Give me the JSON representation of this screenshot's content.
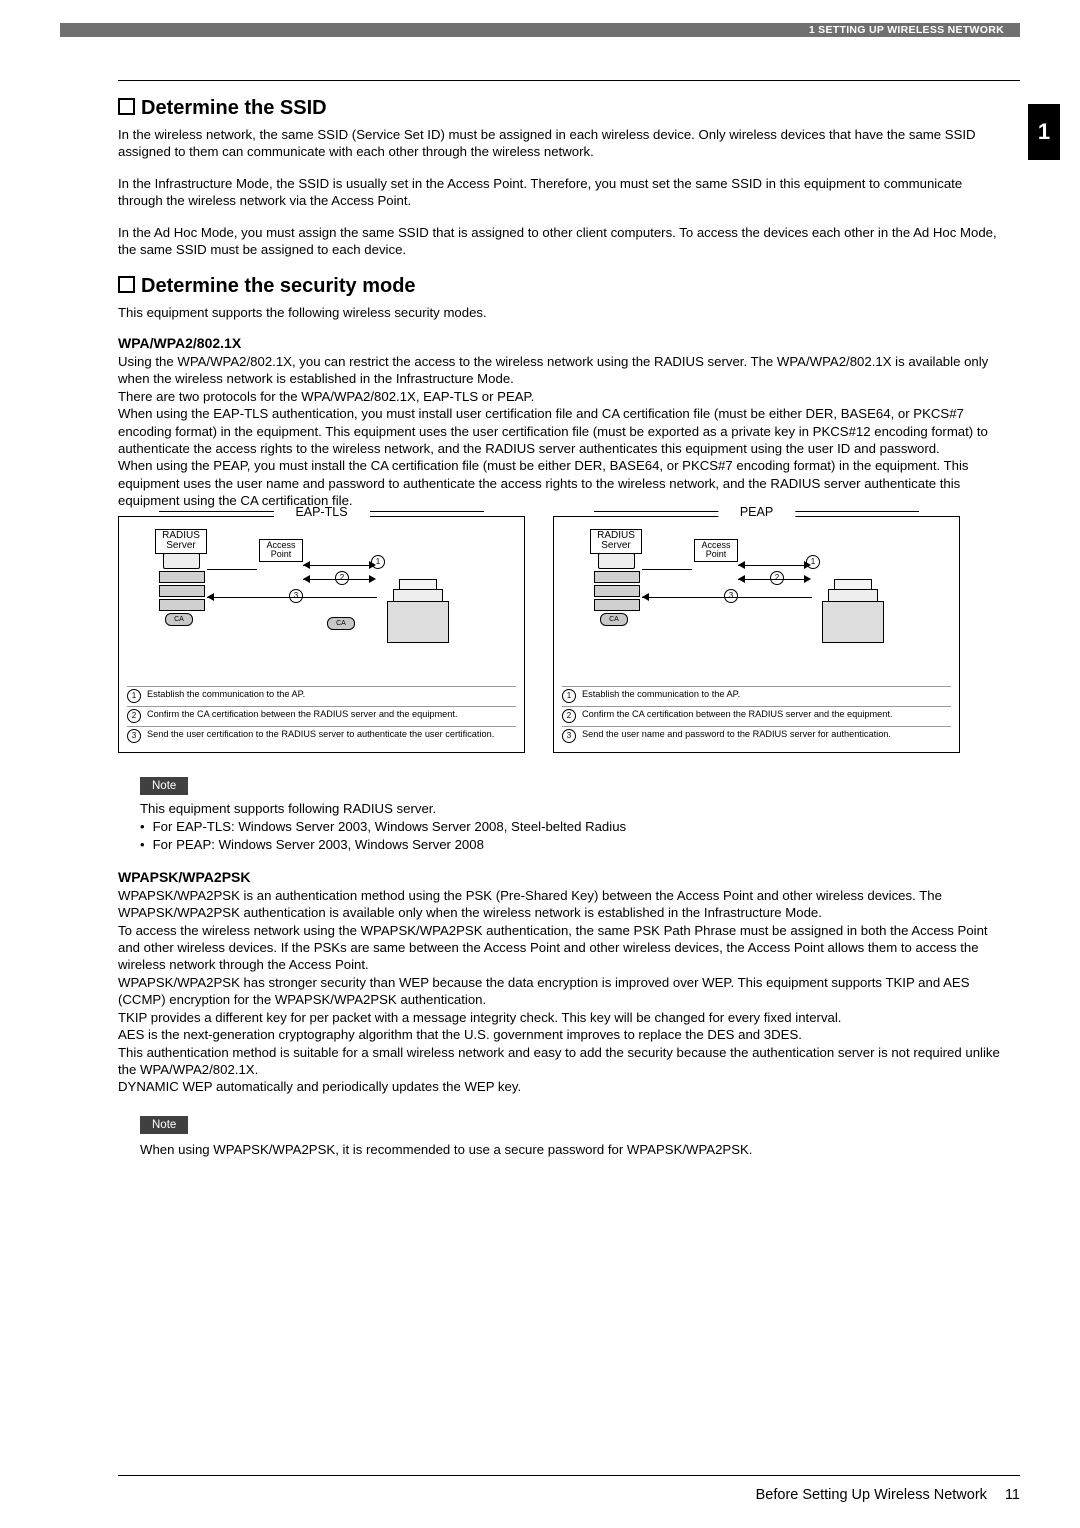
{
  "header": {
    "breadcrumb": "1 SETTING UP WIRELESS NETWORK",
    "chapter_tab": "1"
  },
  "sections": {
    "ssid": {
      "title": "Determine the SSID",
      "p1": "In the wireless network, the same SSID (Service Set ID) must be assigned in each wireless device.  Only wireless devices that have the same SSID assigned to them can communicate with each other through the wireless network.",
      "p2": "In the Infrastructure Mode, the SSID is usually set in the Access Point. Therefore, you must set the same SSID in this equipment to communicate through the wireless network via the Access Point.",
      "p3": "In the Ad Hoc Mode, you must assign the same SSID that is assigned to other client computers.  To access the devices each other in the Ad Hoc Mode, the same SSID must be assigned to each device."
    },
    "security": {
      "title": "Determine the security mode",
      "intro": "This equipment supports the following wireless security modes.",
      "wpa8021x": {
        "heading": "WPA/WPA2/802.1X",
        "body": "Using the WPA/WPA2/802.1X, you can restrict the access to the wireless network using the RADIUS server. The WPA/WPA2/802.1X is available only when the wireless network is established in the Infrastructure Mode.\nThere are two protocols for the WPA/WPA2/802.1X, EAP-TLS or PEAP.\nWhen using the EAP-TLS authentication, you must install user certification file and CA certification file (must be either DER, BASE64, or PKCS#7 encoding format) in the equipment. This equipment uses the user certification file (must be exported as a private key in PKCS#12 encoding format) to authenticate the access rights to the wireless network, and the RADIUS server authenticates this equipment using the user ID and password.\nWhen using the PEAP, you must install the CA certification file (must be either DER, BASE64, or PKCS#7 encoding format) in the equipment. This equipment uses the user name and password to authenticate the access rights to the wireless network, and the RADIUS server authenticate this equipment using the CA certification file."
      },
      "diagrams": {
        "left_title": "EAP-TLS",
        "right_title": "PEAP",
        "radius_label": "RADIUS\nServer",
        "ap_label": "Access\nPoint",
        "ca_label": "CA",
        "eaptls_steps": {
          "s1": "Establish the communication to the AP.",
          "s2": "Confirm the CA certification between the RADIUS server and the equipment.",
          "s3": "Send the user certification to the RADIUS server to authenticate the user certification."
        },
        "peap_steps": {
          "s1": "Establish the communication to the AP.",
          "s2": "Confirm the CA certification between the RADIUS server and the equipment.",
          "s3": "Send the user name and password to the RADIUS server for authentication."
        }
      },
      "note1": {
        "label": "Note",
        "lead": "This equipment supports following RADIUS server.",
        "li1": "For EAP-TLS: Windows Server 2003, Windows Server 2008, Steel-belted Radius",
        "li2": "For PEAP: Windows Server 2003, Windows Server 2008"
      },
      "wpapsk": {
        "heading": "WPAPSK/WPA2PSK",
        "body": "WPAPSK/WPA2PSK is an authentication method using the PSK (Pre-Shared Key) between the Access Point and other wireless devices. The WPAPSK/WPA2PSK authentication is available only when the wireless network is established in the Infrastructure Mode.\nTo access the wireless network using the WPAPSK/WPA2PSK authentication, the same PSK Path Phrase must be assigned in both the Access Point and other wireless devices. If the PSKs are same between the Access Point and other wireless devices, the Access Point allows them to access the wireless network through the Access Point.\nWPAPSK/WPA2PSK has stronger security than WEP because the data encryption is improved over WEP. This equipment supports TKIP and AES (CCMP) encryption for the WPAPSK/WPA2PSK authentication.\nTKIP provides a different key for per packet with a message integrity check.  This key will be changed for every fixed interval.\nAES is the next-generation cryptography algorithm that the U.S. government improves to replace the DES and 3DES.\nThis authentication method is suitable for a small wireless network and easy to add the security because the authentication server is not required unlike the WPA/WPA2/802.1X.\nDYNAMIC WEP automatically and periodically updates the WEP key."
      },
      "note2": {
        "label": "Note",
        "text": "When using WPAPSK/WPA2PSK, it is recommended to use a secure password for WPAPSK/WPA2PSK."
      }
    }
  },
  "footer": {
    "section_name": "Before Setting Up Wireless Network",
    "page_number": "11"
  }
}
